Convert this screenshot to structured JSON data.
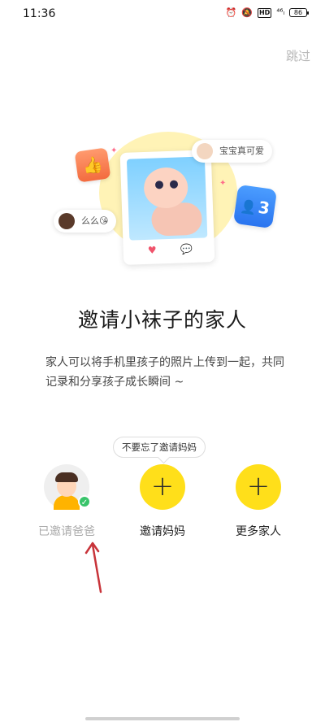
{
  "status_bar": {
    "time": "11:36",
    "network": "⁴⁶ₗ",
    "hd": "HD",
    "battery": "86"
  },
  "skip_label": "跳过",
  "illustration": {
    "bubble_right_text": "宝宝真可爱",
    "bubble_left_text": "么么😘",
    "badge_count": "3"
  },
  "title": "邀请小袜子的家人",
  "description": "家人可以将手机里孩子的照片上传到一起，共同记录和分享孩子成长瞬间 ~",
  "tooltip": "不要忘了邀请妈妈",
  "members": [
    {
      "label": "已邀请爸爸",
      "state": "invited"
    },
    {
      "label": "邀请妈妈",
      "state": "add"
    },
    {
      "label": "更多家人",
      "state": "add"
    }
  ],
  "colors": {
    "accent_yellow": "#ffdf1a",
    "check_green": "#39c46b",
    "arrow_red": "#c8343a"
  }
}
